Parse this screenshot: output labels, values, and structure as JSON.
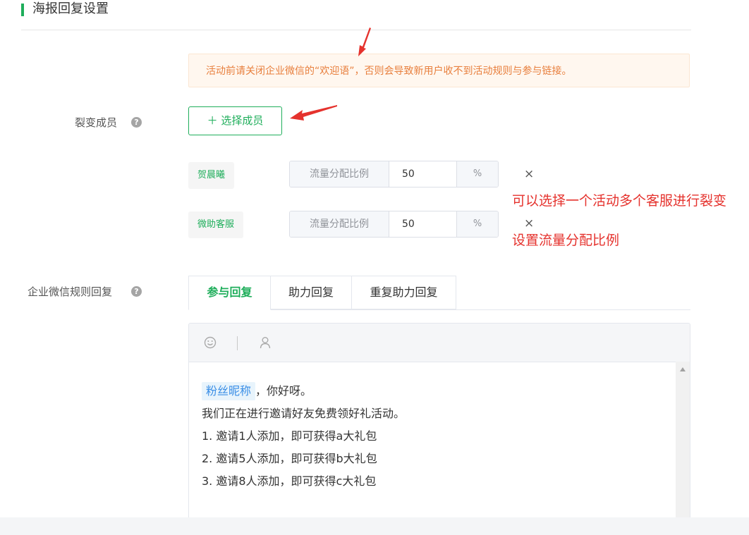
{
  "section": {
    "title": "海报回复设置"
  },
  "notice": {
    "text": "活动前请关闭企业微信的“欢迎语”，否则会导致新用户收不到活动规则与参与链接。"
  },
  "members_field": {
    "label": "裂变成员",
    "help": "?",
    "select_button": "＋ 选择成员",
    "members": [
      {
        "name": "贺晨曦",
        "ratio_label": "流量分配比例",
        "ratio_value": "50",
        "unit": "%",
        "remove": "×"
      },
      {
        "name": "微助客服",
        "ratio_label": "流量分配比例",
        "ratio_value": "50",
        "unit": "%",
        "remove": "×"
      }
    ]
  },
  "annotations": {
    "multi_service": "可以选择一个活动多个客服进行裂变",
    "set_ratio": "设置流量分配比例"
  },
  "reply_field": {
    "label": "企业微信规则回复",
    "help": "?",
    "tabs": [
      {
        "label": "参与回复",
        "active": true
      },
      {
        "label": "助力回复",
        "active": false
      },
      {
        "label": "重复助力回复",
        "active": false
      }
    ]
  },
  "editor": {
    "toolbar": {
      "emoji_icon": "smile-icon",
      "user_icon": "user-icon"
    },
    "fan_tag": "粉丝昵称",
    "greeting_suffix": "，你好呀。",
    "lines": [
      "我们正在进行邀请好友免费领好礼活动。",
      "1. 邀请1人添加，即可获得a大礼包",
      "2. 邀请5人添加，即可获得b大礼包",
      "3. 邀请8人添加，即可获得c大礼包"
    ]
  },
  "colors": {
    "accent": "#1fae5b",
    "warning": "#e87f3d",
    "annotation": "#e5322d",
    "tag_blue": "#3a8ee6"
  }
}
